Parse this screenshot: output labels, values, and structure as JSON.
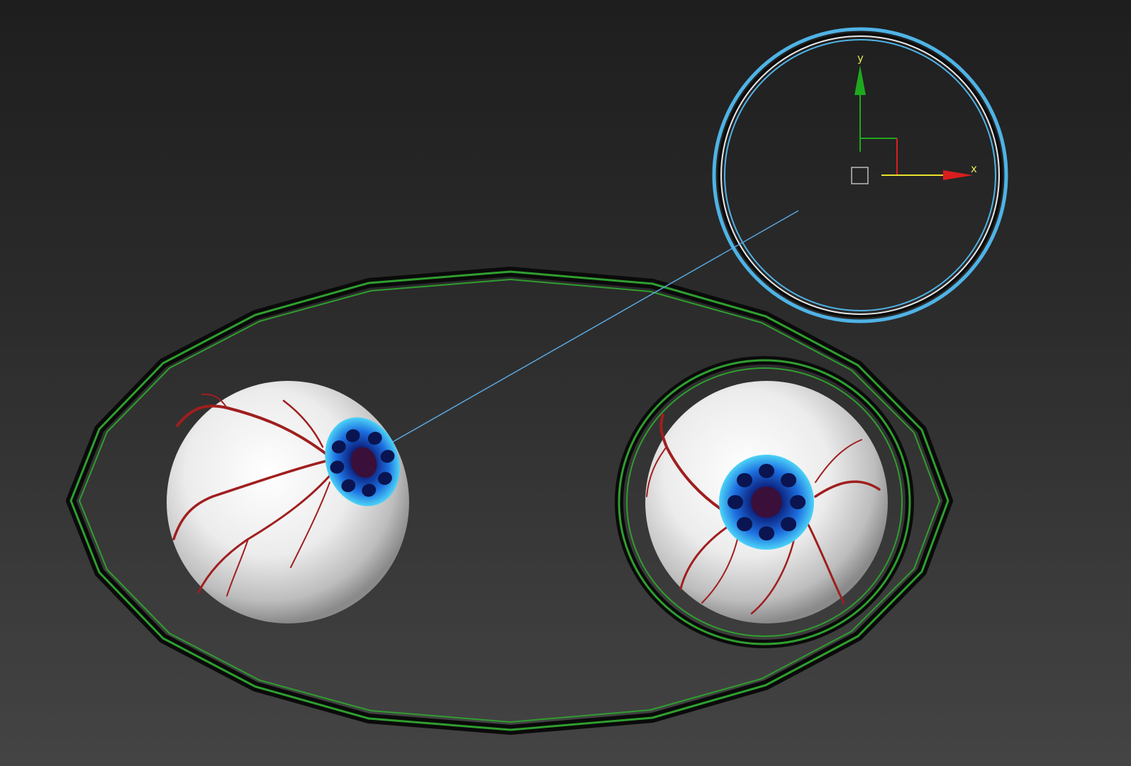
{
  "viewport": {
    "background_top": "#1e1e1e",
    "background_bottom": "#444444"
  },
  "control_colors": {
    "selected_control": "#4fb3e6",
    "unselected_control": "#2f9e2f",
    "link_line": "#5aa7e0"
  },
  "gizmo": {
    "x_axis_label": "x",
    "y_axis_label": "y",
    "x_color": "#e6e12e",
    "y_color": "#1fa81f",
    "x_arrow_color": "#d81e1e",
    "y_arrow_color": "#1fa81f"
  },
  "eyes": {
    "left": {
      "iris_color": "#33c5f0",
      "vein_color": "#a01e1e"
    },
    "right": {
      "iris_color": "#33c5f0",
      "vein_color": "#a01e1e"
    }
  }
}
